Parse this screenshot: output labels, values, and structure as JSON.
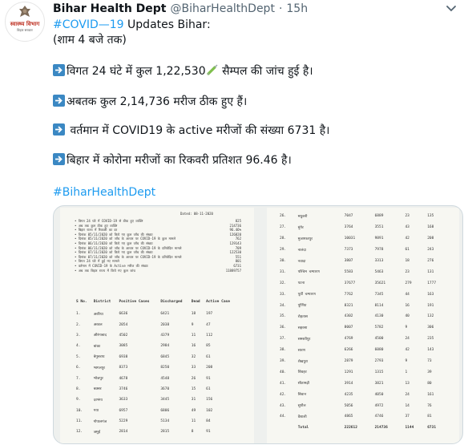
{
  "tweet": {
    "account_name": "Bihar Health Dept",
    "handle": "@BiharHealthDept",
    "separator": "·",
    "time": "15h",
    "avatar_title": "स्वास्थ्य विभाग",
    "avatar_subtitle": "बिहार सरकार",
    "hashtag_covid": "#COVID—19",
    "line1_rest": " Updates Bihar:",
    "line2": "(शाम 4 बजे तक)",
    "bullet1_pre": "विगत 24 घंटे में कुल 1,22,530",
    "bullet1_post": " सैम्पल की जांच हुई है।",
    "bullet2": "अबतक कुल 2,14,736 मरीज ठीक हुए हैं।",
    "bullet3": " वर्तमान में COVID19 के active मरीजों की संख्या 6731 है।",
    "bullet4": "बिहार में कोरोना मरीजों का रिकवरी प्रतिशत 96.46 है।",
    "hashtag_footer": "#BiharHealthDept"
  },
  "icons": {
    "avatar": "bihar-seal-icon",
    "caret": "chevron-down-icon",
    "bullets": "right-arrow-icon",
    "syringe": "syringe-icon"
  },
  "colors": {
    "link": "#1d9bf0",
    "arrow_box": "#3b88c3",
    "secondary_text": "#536471"
  },
  "document": {
    "date_label": "Dated: 08-11-2020",
    "summary": [
      {
        "label": "विगत 24 घंटे में COVID-19 से ठीक हुए व्यक्ति",
        "value": "825"
      },
      {
        "label": "अब तक कुल ठीक हुए व्यक्ति",
        "value": "214736"
      },
      {
        "label": "बिहार राज्य में रिकवरी का दर",
        "value": "96.46%"
      },
      {
        "label": "दिनांक 05/11/2020 को किये गए कुल जाँच की संख्या",
        "value": "126820"
      },
      {
        "label": "दिनांक 05/11/2020 को जाँच के आधार पर COVID-19 के कुल मामले",
        "value": "762"
      },
      {
        "label": "दिनांक 06/11/2020 को किये गए कुल जाँच की संख्या",
        "value": "129143"
      },
      {
        "label": "दिनांक 06/11/2020 को जाँच के आधार पर COVID-19 के प्रतिवेदित मामले",
        "value": "709"
      },
      {
        "label": "दिनांक 07/11/2020 को किये गए कुल जाँच की संख्या",
        "value": "122530"
      },
      {
        "label": "दिनांक 07/11/2020 को जाँच के आधार पर COVID-19 के प्रतिवेदित मामले",
        "value": "551"
      },
      {
        "label": "विगत 24 घंटे में हुई नए मामले",
        "value": "801"
      },
      {
        "label": "वर्तमान में COVID-19 के Active मरीज की संख्या",
        "value": "6731"
      },
      {
        "label": "अब तक बिहार राज्य में किये गए कुल जांच",
        "value": "11889757"
      }
    ],
    "left_headers": [
      "S No.",
      "District",
      "Positive Cases",
      "Discharged",
      "Dead",
      "Active Case"
    ],
    "left_rows": [
      [
        "1.",
        "अररिया",
        "6636",
        "6421",
        "18",
        "197"
      ],
      [
        "2.",
        "अरवल",
        "2054",
        "2038",
        "9",
        "47"
      ],
      [
        "3.",
        "औरंगाबाद",
        "4502",
        "4379",
        "11",
        "112"
      ],
      [
        "4.",
        "बांका",
        "3085",
        "2984",
        "16",
        "85"
      ],
      [
        "5.",
        "बेगूसराय",
        "6938",
        "6845",
        "32",
        "61"
      ],
      [
        "6.",
        "भागलपुर",
        "8373",
        "8250",
        "33",
        "208"
      ],
      [
        "7.",
        "भोजपुर",
        "4678",
        "4548",
        "26",
        "91"
      ],
      [
        "8.",
        "बक्सर",
        "3746",
        "3670",
        "15",
        "61"
      ],
      [
        "9.",
        "दरभंगा",
        "3633",
        "3445",
        "31",
        "156"
      ],
      [
        "10.",
        "गया",
        "6957",
        "6806",
        "49",
        "102"
      ],
      [
        "11.",
        "गोपालगंज",
        "5229",
        "5134",
        "11",
        "84"
      ],
      [
        "12.",
        "जमुई",
        "2814",
        "2815",
        "8",
        "91"
      ]
    ],
    "right_rows": [
      [
        "26.",
        "मधुबनी",
        "7047",
        "6889",
        "23",
        "135"
      ],
      [
        "27.",
        "मुंगेर",
        "3764",
        "3551",
        "43",
        "168"
      ],
      [
        "28.",
        "मुजफ्फरपुर",
        "10031",
        "9891",
        "42",
        "208"
      ],
      [
        "29.",
        "नालंदा",
        "7373",
        "7978",
        "61",
        "243"
      ],
      [
        "30.",
        "नवादा",
        "3807",
        "3313",
        "18",
        "276"
      ],
      [
        "31.",
        "पश्चिम चम्पारण",
        "5583",
        "5463",
        "23",
        "131"
      ],
      [
        "32.",
        "पटना",
        "37677",
        "35621",
        "279",
        "1777"
      ],
      [
        "33.",
        "पूर्वी चम्पारण",
        "7762",
        "7345",
        "44",
        "163"
      ],
      [
        "34.",
        "पूर्णिया",
        "8321",
        "8114",
        "16",
        "191"
      ],
      [
        "35.",
        "रोहतास",
        "4302",
        "4130",
        "40",
        "132"
      ],
      [
        "36.",
        "सहरसा",
        "8007",
        "5782",
        "9",
        "306"
      ],
      [
        "37.",
        "समस्तीपुर",
        "4769",
        "4500",
        "24",
        "235"
      ],
      [
        "38.",
        "सारण",
        "6266",
        "6080",
        "42",
        "143"
      ],
      [
        "39.",
        "शेखपुरा",
        "2879",
        "2793",
        "9",
        "73"
      ],
      [
        "40.",
        "शिवहर",
        "1291",
        "1315",
        "1",
        "39"
      ],
      [
        "41.",
        "सीतामढ़ी",
        "3914",
        "3821",
        "13",
        "80"
      ],
      [
        "42.",
        "सिवान",
        "4235",
        "4050",
        "24",
        "161"
      ],
      [
        "43.",
        "सुपौल",
        "5056",
        "4972",
        "14",
        "76"
      ],
      [
        "44.",
        "वैशाली",
        "4865",
        "4746",
        "37",
        "81"
      ]
    ],
    "total_row": [
      "",
      "Total",
      "222612",
      "214736",
      "1144",
      "6731"
    ]
  }
}
